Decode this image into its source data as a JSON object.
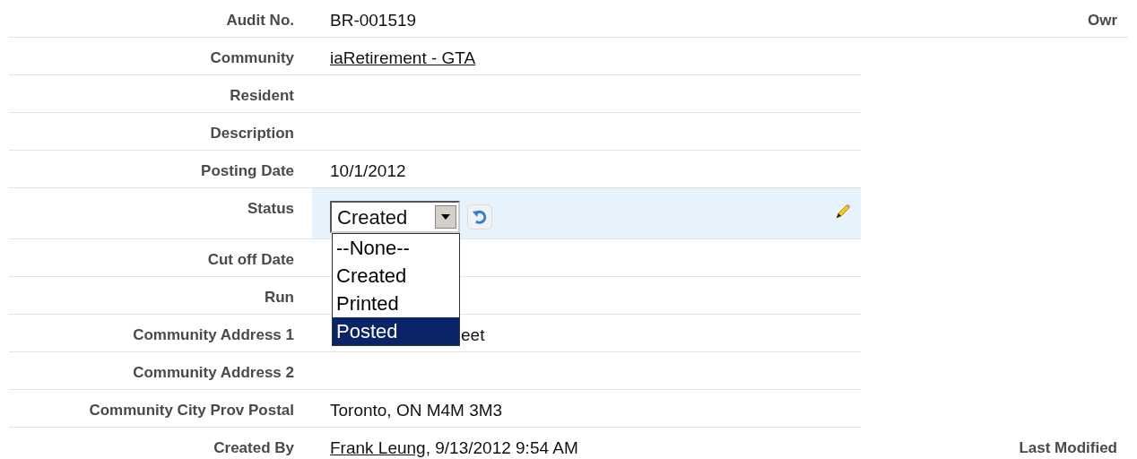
{
  "rows": [
    {
      "label": "Audit No.",
      "kind": "text",
      "value": "BR-001519",
      "right_label": "Owr"
    },
    {
      "label": "Community",
      "kind": "link",
      "value": "iaRetirement - GTA"
    },
    {
      "label": "Resident",
      "kind": "text"
    },
    {
      "label": "Description",
      "kind": "text"
    },
    {
      "label": "Posting Date",
      "kind": "text",
      "value": "10/1/2012"
    },
    {
      "label": "Status",
      "kind": "select",
      "editing": true,
      "value": "Created",
      "expanded": true,
      "options": [
        {
          "label": "--None--",
          "highlighted": false
        },
        {
          "label": "Created",
          "highlighted": false
        },
        {
          "label": "Printed",
          "highlighted": false
        },
        {
          "label": "Posted",
          "highlighted": true
        }
      ]
    },
    {
      "label": "Cut off Date",
      "kind": "text"
    },
    {
      "label": "Run",
      "kind": "text"
    },
    {
      "label": "Community Address 1",
      "kind": "covered",
      "value": "eet"
    },
    {
      "label": "Community Address 2",
      "kind": "text"
    },
    {
      "label": "Community City Prov Postal",
      "kind": "text",
      "value": "Toronto, ON M4M 3M3"
    },
    {
      "label": "Created By",
      "kind": "user",
      "link": "Frank Leung",
      "value": ", 9/13/2012 9:54 AM",
      "right_label": "Last Modified"
    }
  ]
}
